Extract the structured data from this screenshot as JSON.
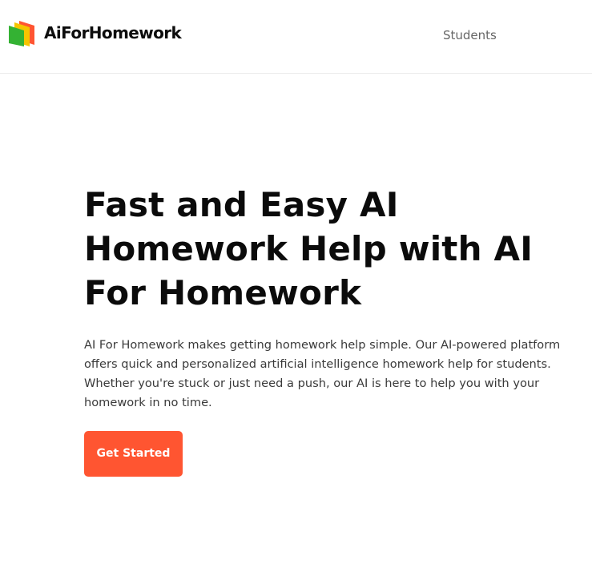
{
  "brand": {
    "logo_icon": "book-stack-logo",
    "name": "AiForHomework",
    "colors": {
      "green": "#34b233",
      "yellow": "#f5c400",
      "orange": "#ff5531"
    }
  },
  "nav": {
    "items": [
      {
        "label": "Students"
      }
    ]
  },
  "hero": {
    "title": "Fast and Easy AI Homework Help with AI For Homework",
    "description": "AI For Homework makes getting homework help simple. Our AI-powered platform offers quick and personalized artificial intelligence homework help for students. Whether you're stuck or just need a push, our AI is here to help you with your homework in no time.",
    "cta_label": "Get Started",
    "cta_color": "#ff5531"
  }
}
